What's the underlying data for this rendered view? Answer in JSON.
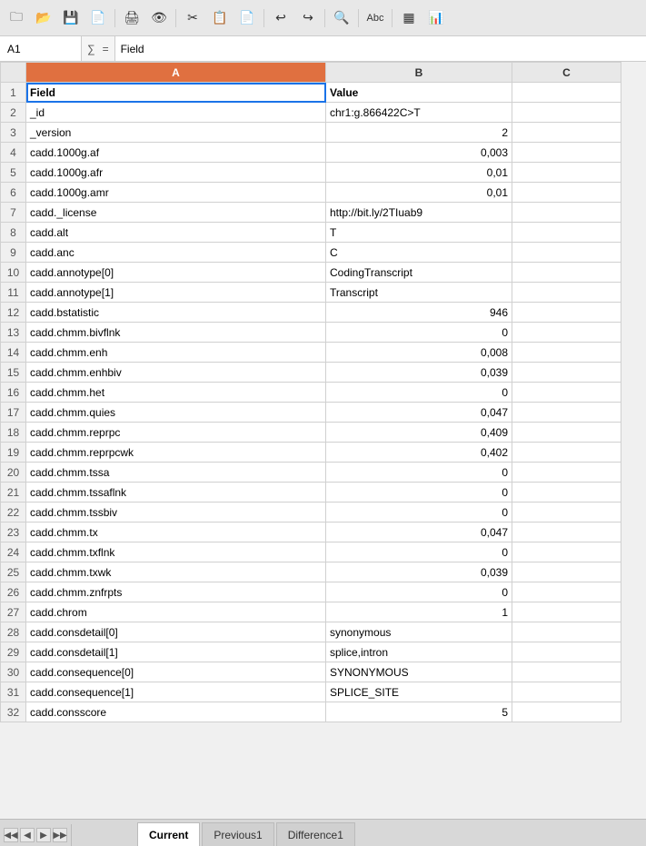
{
  "toolbar": {
    "buttons": [
      "🗀",
      "💾",
      "⟲",
      "🖨",
      "👁",
      "✂",
      "📋",
      "📄",
      "↩",
      "↪",
      "🔍",
      "Abc",
      "▦",
      "📊"
    ]
  },
  "formula_bar": {
    "cell_ref": "A1",
    "formula_value": "Field"
  },
  "columns": {
    "a_header": "A",
    "b_header": "B",
    "c_header": "C"
  },
  "rows": [
    {
      "num": "1",
      "a": "Field",
      "b": "Value",
      "b_align": "left"
    },
    {
      "num": "2",
      "a": "_id",
      "b": "chr1:g.866422C>T",
      "b_align": "left"
    },
    {
      "num": "3",
      "a": "_version",
      "b": "2",
      "b_align": "right"
    },
    {
      "num": "4",
      "a": "cadd.1000g.af",
      "b": "0,003",
      "b_align": "right"
    },
    {
      "num": "5",
      "a": "cadd.1000g.afr",
      "b": "0,01",
      "b_align": "right"
    },
    {
      "num": "6",
      "a": "cadd.1000g.amr",
      "b": "0,01",
      "b_align": "right"
    },
    {
      "num": "7",
      "a": "cadd._license",
      "b": "http://bit.ly/2TIuab9",
      "b_align": "left"
    },
    {
      "num": "8",
      "a": "cadd.alt",
      "b": "T",
      "b_align": "left"
    },
    {
      "num": "9",
      "a": "cadd.anc",
      "b": "C",
      "b_align": "left"
    },
    {
      "num": "10",
      "a": "cadd.annotype[0]",
      "b": "CodingTranscript",
      "b_align": "left"
    },
    {
      "num": "11",
      "a": "cadd.annotype[1]",
      "b": "Transcript",
      "b_align": "left"
    },
    {
      "num": "12",
      "a": "cadd.bstatistic",
      "b": "946",
      "b_align": "right"
    },
    {
      "num": "13",
      "a": "cadd.chmm.bivflnk",
      "b": "0",
      "b_align": "right"
    },
    {
      "num": "14",
      "a": "cadd.chmm.enh",
      "b": "0,008",
      "b_align": "right"
    },
    {
      "num": "15",
      "a": "cadd.chmm.enhbiv",
      "b": "0,039",
      "b_align": "right"
    },
    {
      "num": "16",
      "a": "cadd.chmm.het",
      "b": "0",
      "b_align": "right"
    },
    {
      "num": "17",
      "a": "cadd.chmm.quies",
      "b": "0,047",
      "b_align": "right"
    },
    {
      "num": "18",
      "a": "cadd.chmm.reprpc",
      "b": "0,409",
      "b_align": "right"
    },
    {
      "num": "19",
      "a": "cadd.chmm.reprpcwk",
      "b": "0,402",
      "b_align": "right"
    },
    {
      "num": "20",
      "a": "cadd.chmm.tssa",
      "b": "0",
      "b_align": "right"
    },
    {
      "num": "21",
      "a": "cadd.chmm.tssaflnk",
      "b": "0",
      "b_align": "right"
    },
    {
      "num": "22",
      "a": "cadd.chmm.tssbiv",
      "b": "0",
      "b_align": "right"
    },
    {
      "num": "23",
      "a": "cadd.chmm.tx",
      "b": "0,047",
      "b_align": "right"
    },
    {
      "num": "24",
      "a": "cadd.chmm.txflnk",
      "b": "0",
      "b_align": "right"
    },
    {
      "num": "25",
      "a": "cadd.chmm.txwk",
      "b": "0,039",
      "b_align": "right"
    },
    {
      "num": "26",
      "a": "cadd.chmm.znfrpts",
      "b": "0",
      "b_align": "right"
    },
    {
      "num": "27",
      "a": "cadd.chrom",
      "b": "1",
      "b_align": "right"
    },
    {
      "num": "28",
      "a": "cadd.consdetail[0]",
      "b": "synonymous",
      "b_align": "left"
    },
    {
      "num": "29",
      "a": "cadd.consdetail[1]",
      "b": "splice,intron",
      "b_align": "left"
    },
    {
      "num": "30",
      "a": "cadd.consequence[0]",
      "b": "SYNONYMOUS",
      "b_align": "left"
    },
    {
      "num": "31",
      "a": "cadd.consequence[1]",
      "b": "SPLICE_SITE",
      "b_align": "left"
    },
    {
      "num": "32",
      "a": "cadd.consscore",
      "b": "5",
      "b_align": "right"
    }
  ],
  "tabs": [
    {
      "label": "Current",
      "active": true
    },
    {
      "label": "Previous1",
      "active": false
    },
    {
      "label": "Difference1",
      "active": false
    }
  ],
  "tab_nav": {
    "first": "◀◀",
    "prev": "◀",
    "next": "▶",
    "last": "▶▶"
  }
}
